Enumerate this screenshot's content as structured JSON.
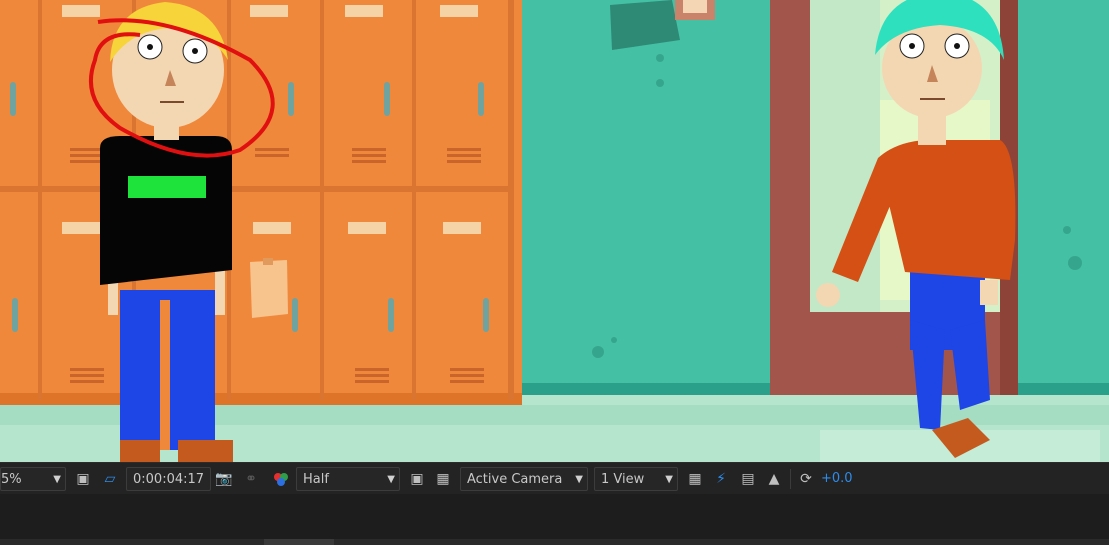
{
  "viewer": {
    "scene": "school hallway with orange lockers, a boy in black shirt and blue pants, a green-haired boy in orange sweater walking through a door"
  },
  "toolbar": {
    "zoom_value": "5%",
    "timecode": "0:00:04:17",
    "resolution": "Half",
    "camera": "Active Camera",
    "views": "1 View",
    "exposure_offset": "+0.0"
  },
  "icons": {
    "region_of_interest": "region-of-interest-icon",
    "mask_toggle": "mask-path-icon",
    "snapshot": "camera-icon",
    "show_snapshot": "show-snapshot-icon",
    "color_channels": "color-channels-icon",
    "fast_preview": "fast-preview-icon",
    "transparency_grid": "transparency-grid-icon",
    "reset_exposure": "reset-exposure-icon"
  },
  "colors": {
    "accent": "#2d8ceb",
    "locker": "#f0883c",
    "wall": "#45c1a6",
    "annotation_circle": "#e01010"
  }
}
